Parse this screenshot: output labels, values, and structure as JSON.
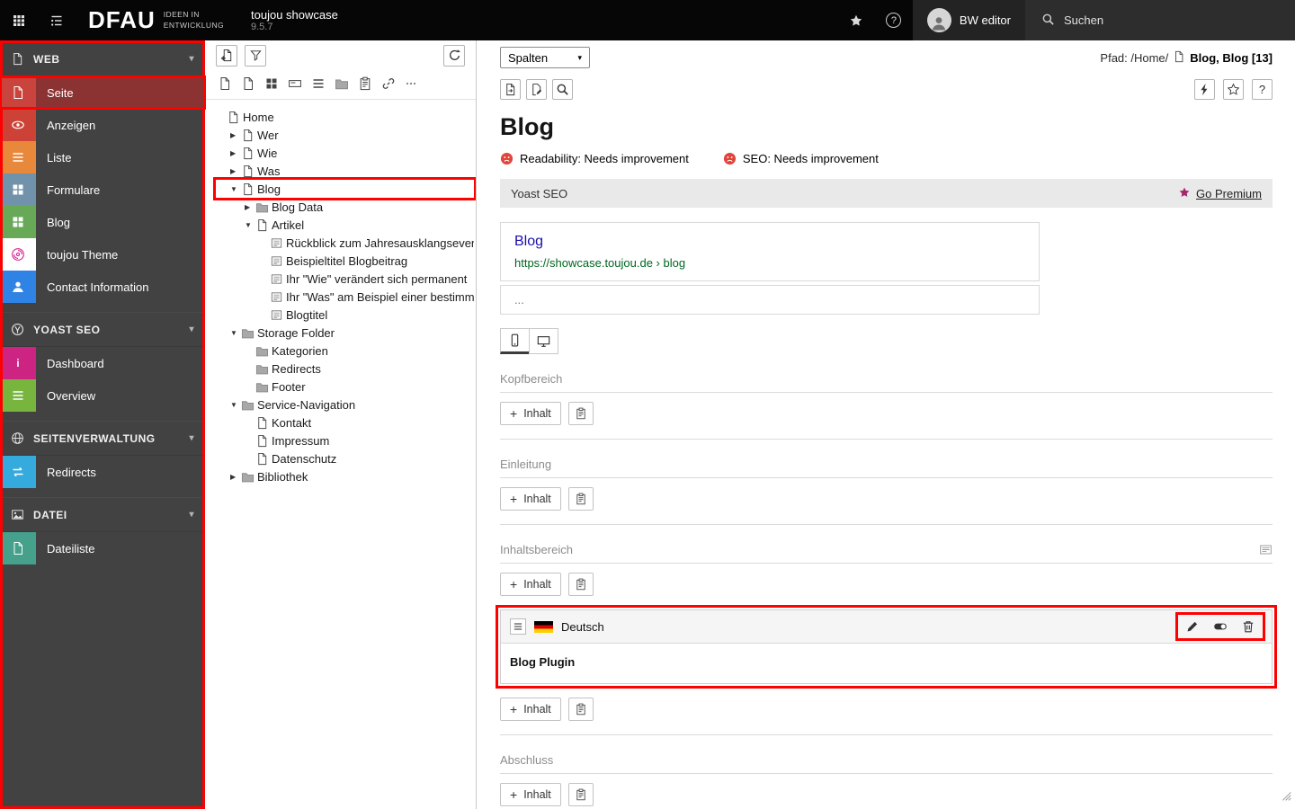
{
  "topbar": {
    "logo_text": "DFAU",
    "logo_tagline_1": "IDEEN IN",
    "logo_tagline_2": "ENTWICKLUNG",
    "site_title": "toujou showcase",
    "version": "9.5.7",
    "username": "BW editor",
    "search_label": "Suchen"
  },
  "sidebar": {
    "sections": [
      {
        "label": "WEB",
        "icon": "web-group-icon",
        "items": [
          {
            "label": "Seite",
            "icon": "page-module-icon",
            "color": "#c9443c",
            "active": true,
            "annotated": true
          },
          {
            "label": "Anzeigen",
            "icon": "view-module-icon",
            "color": "#cc4237"
          },
          {
            "label": "Liste",
            "icon": "list-module-icon",
            "color": "#e8883a"
          },
          {
            "label": "Formulare",
            "icon": "forms-module-icon",
            "color": "#7092ab"
          },
          {
            "label": "Blog",
            "icon": "blog-module-icon",
            "color": "#67a957"
          },
          {
            "label": "toujou Theme",
            "icon": "fingerprint-icon",
            "color": "#ffffff",
            "glyph_color": "#d6218f"
          },
          {
            "label": "Contact Information",
            "icon": "contact-module-icon",
            "color": "#2f83e4"
          }
        ]
      },
      {
        "label": "YOAST SEO",
        "icon": "yoast-group-icon",
        "items": [
          {
            "label": "Dashboard",
            "icon": "dashboard-module-icon",
            "color": "#cd2382"
          },
          {
            "label": "Overview",
            "icon": "overview-module-icon",
            "color": "#77b53f"
          }
        ]
      },
      {
        "label": "SEITENVERWALTUNG",
        "icon": "sitemgmt-group-icon",
        "items": [
          {
            "label": "Redirects",
            "icon": "redirects-module-icon",
            "color": "#35aadd"
          }
        ]
      },
      {
        "label": "DATEI",
        "icon": "file-group-icon",
        "items": [
          {
            "label": "Dateiliste",
            "icon": "filelist-module-icon",
            "color": "#45a08c"
          }
        ]
      }
    ]
  },
  "pagetree": {
    "toolbar_icons": [
      "new-page-icon",
      "filter-icon",
      "refresh-icon"
    ],
    "page_types": [
      {
        "name": "page",
        "icon": "doc"
      },
      {
        "name": "page-shortcut",
        "icon": "doc"
      },
      {
        "name": "mount",
        "icon": "grid4"
      },
      {
        "name": "banner",
        "icon": "banner"
      },
      {
        "name": "text",
        "icon": "lines"
      },
      {
        "name": "folder",
        "icon": "folder"
      },
      {
        "name": "paste",
        "icon": "clipboard"
      },
      {
        "name": "link",
        "icon": "chain"
      },
      {
        "name": "divider",
        "icon": "divider"
      }
    ],
    "nodes": [
      {
        "label": "Home",
        "depth": 0,
        "icon": "page",
        "expander": "none"
      },
      {
        "label": "Wer",
        "depth": 1,
        "icon": "page",
        "expander": "collapsed"
      },
      {
        "label": "Wie",
        "depth": 1,
        "icon": "page",
        "expander": "collapsed"
      },
      {
        "label": "Was",
        "depth": 1,
        "icon": "page",
        "expander": "collapsed"
      },
      {
        "label": "Blog",
        "depth": 1,
        "icon": "page",
        "expander": "expanded",
        "selected": true,
        "annotated": true
      },
      {
        "label": "Blog Data",
        "depth": 2,
        "icon": "folder",
        "expander": "collapsed"
      },
      {
        "label": "Artikel",
        "depth": 2,
        "icon": "page",
        "expander": "expanded"
      },
      {
        "label": "Rückblick zum Jahresausklangsever",
        "depth": 3,
        "icon": "article",
        "expander": "none"
      },
      {
        "label": "Beispieltitel Blogbeitrag",
        "depth": 3,
        "icon": "article",
        "expander": "none"
      },
      {
        "label": "Ihr \"Wie\" verändert sich permanent",
        "depth": 3,
        "icon": "article",
        "expander": "none"
      },
      {
        "label": "Ihr \"Was\" am Beispiel einer bestimm",
        "depth": 3,
        "icon": "article",
        "expander": "none"
      },
      {
        "label": "Blogtitel",
        "depth": 3,
        "icon": "article",
        "expander": "none"
      },
      {
        "label": "Storage Folder",
        "depth": 1,
        "icon": "folder",
        "expander": "expanded"
      },
      {
        "label": "Kategorien",
        "depth": 2,
        "icon": "folder",
        "expander": "none"
      },
      {
        "label": "Redirects",
        "depth": 2,
        "icon": "folder",
        "expander": "none"
      },
      {
        "label": "Footer",
        "depth": 2,
        "icon": "folder",
        "expander": "none"
      },
      {
        "label": "Service-Navigation",
        "depth": 1,
        "icon": "folder",
        "expander": "expanded"
      },
      {
        "label": "Kontakt",
        "depth": 2,
        "icon": "page",
        "expander": "none"
      },
      {
        "label": "Impressum",
        "depth": 2,
        "icon": "page",
        "expander": "none"
      },
      {
        "label": "Datenschutz",
        "depth": 2,
        "icon": "page",
        "expander": "none"
      },
      {
        "label": "Bibliothek",
        "depth": 1,
        "icon": "folder",
        "expander": "collapsed"
      }
    ]
  },
  "docheader": {
    "columns_select_label": "Spalten",
    "path_prefix": "Pfad: /Home/",
    "current_record": "Blog, Blog [13]",
    "left_buttons": [
      {
        "name": "view-page-button",
        "icon": "docarrow"
      },
      {
        "name": "edit-page-button",
        "icon": "docpencil"
      },
      {
        "name": "search-button",
        "icon": "magnifier"
      }
    ],
    "right_buttons": [
      {
        "name": "clear-cache-button",
        "icon": "bolt"
      },
      {
        "name": "bookmark-button",
        "icon": "staro"
      },
      {
        "name": "help-button",
        "icon": "question"
      }
    ]
  },
  "content": {
    "page_title": "Blog",
    "statuses": [
      {
        "icon": "frown",
        "label": "Readability: Needs improvement"
      },
      {
        "icon": "frown",
        "label": "SEO: Needs improvement"
      }
    ],
    "yoast": {
      "title": "Yoast SEO",
      "premium_link": "Go Premium",
      "premium_star_color": "#a4286a",
      "snippet_title": "Blog",
      "snippet_url": "https://showcase.toujou.de › blog",
      "snippet_description": "...",
      "device_toggle": [
        "mobile",
        "desktop"
      ],
      "active_device": "mobile"
    },
    "add_button_label": "Inhalt",
    "sections": [
      {
        "label": "Kopfbereich",
        "rows": [
          "add"
        ]
      },
      {
        "label": "Einleitung",
        "rows": [
          "add"
        ]
      },
      {
        "label": "Inhaltsbereich",
        "note_icon": true,
        "rows": [
          "add",
          "element",
          "add"
        ],
        "element": {
          "language": "Deutsch",
          "flag": "de",
          "title": "Blog Plugin",
          "controls": [
            "edit",
            "visibility",
            "delete"
          ],
          "annotated": true,
          "controls_annotated": true
        }
      },
      {
        "label": "Abschluss",
        "rows": [
          "add"
        ]
      }
    ]
  },
  "annotation_color": "#ff0000"
}
